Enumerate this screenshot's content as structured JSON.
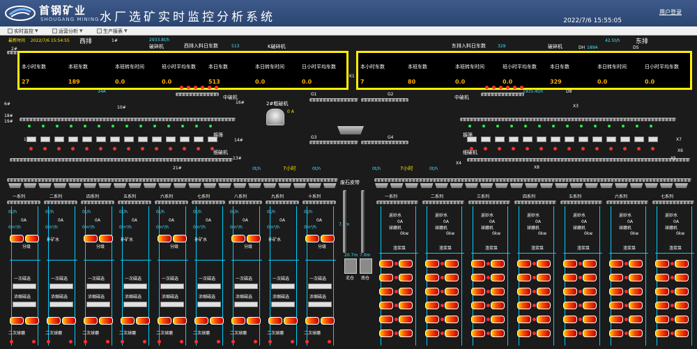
{
  "header": {
    "company_cn": "首钢矿业",
    "company_en": "SHOUGANG MINING",
    "title": "水厂选矿实时监控分析系统",
    "login": "用户登录",
    "datetime": "2022/7/6 15:55:05"
  },
  "menus": [
    {
      "label": "实时监控"
    },
    {
      "label": "运营分析"
    },
    {
      "label": "生产报表"
    }
  ],
  "labels": {
    "latest_time_label": "最新时间",
    "latest_time": "2022/7/6 15:54:55",
    "west": "西排",
    "east": "东排",
    "west_trucks": "西排入料日车数",
    "west_trucks_val": "513",
    "east_trucks": "东排入料日车数",
    "east_trucks_val": "329",
    "crusher_k": "K破碎机",
    "crusher_left": "破碎机",
    "crusher_right": "破碎机",
    "coarse_crusher": "2#粗破机",
    "coarse_val": "0 A",
    "mid_crusher_l": "中破机",
    "mid_crusher_r": "中破机",
    "fine_crusher_l": "细破机",
    "fine_crusher_r": "细破机",
    "screen_l": "振筛",
    "screen_r": "振筛",
    "waste_belt": "废石皮带",
    "north_bin": "北仓",
    "south_bin": "南仓",
    "seven_hour_l": "7小时",
    "seven_hour_r": "7小时",
    "rate_l": "0t/h",
    "rate_r": "0t/h",
    "rate_mid": "0t/h",
    "flow_west": "2933.8t/h",
    "flow_east": "42.5t/h",
    "flow_west2": "1935.4t/h",
    "bin_n": "20.7m",
    "bin_s": "7.0m",
    "belt_7": "7.0m",
    "g1": "G1",
    "g2": "G2",
    "g3": "G3",
    "g4": "G4",
    "x3": "X3",
    "x4": "X4",
    "x5": "X5",
    "x6": "X6",
    "x7": "X7",
    "x8": "X8",
    "k1": "K1",
    "b21": "21#",
    "b16": "16#",
    "b17": "17#",
    "b18": "18#",
    "b19": "19#",
    "b14": "14#",
    "b13": "13#",
    "b6": "6#",
    "b10": "10#",
    "b1": "1#",
    "b2": "2#",
    "dh": "DH",
    "ds": "DS",
    "d8": "D8",
    "dh_val": "189A",
    "ds_val": "34A"
  },
  "kpi_left": {
    "headers": [
      "本小时车数",
      "本班车数",
      "本班转车时间",
      "班小时平均车数",
      "本日车数",
      "本日转车时间",
      "日小时平均车数"
    ],
    "values": [
      "27",
      "189",
      "0.0",
      "0.0",
      "513",
      "0.0",
      "0.0"
    ]
  },
  "kpi_right": {
    "headers": [
      "本小时车数",
      "本班车数",
      "本班转车时间",
      "班小时平均车数",
      "本日车数",
      "本日转车时间",
      "日小时平均车数"
    ],
    "values": [
      "7",
      "80",
      "0.0",
      "0.0",
      "329",
      "0.0",
      "0.0"
    ]
  },
  "west_series": [
    "一系列",
    "二系列",
    "四系列",
    "五系列",
    "六系列",
    "七系列",
    "八系列",
    "九系列",
    "十系列"
  ],
  "east_series": [
    "一系列",
    "二系列",
    "三系列",
    "四系列",
    "五系列",
    "六系列",
    "七系列"
  ],
  "process": {
    "grade": "分级",
    "water": "补矿水",
    "mill_feed": "给矿水",
    "return": "返砂水",
    "pump": "渣浆泵",
    "ball_mill": "球磨机",
    "sec_ball_mill": "二次球磨",
    "thick_sep": "浓缩磁选",
    "one_sep": "一次磁选",
    "zero_a": "0A",
    "zero_kw": "0kw",
    "zero_m3": "0m³/h",
    "zero_t": "0t/h",
    "zero_ma": "0mA"
  },
  "colors": {
    "kpi_border": "#ffef00",
    "kpi_value": "#ffb000",
    "header_bg": "#3e5a8a",
    "line": "#00d0ff"
  }
}
